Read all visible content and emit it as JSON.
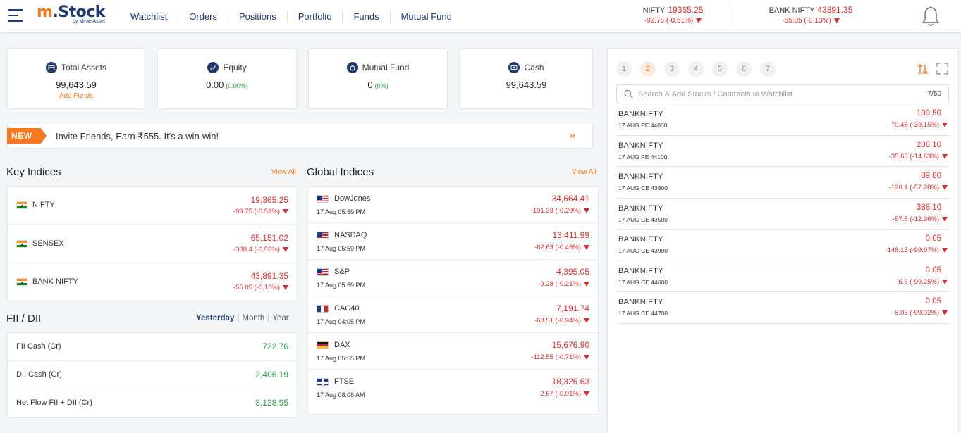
{
  "header": {
    "logo_text_m": "m",
    "logo_text": ".Stock",
    "logo_sub": "by Mirae Asset",
    "nav": [
      "Watchlist",
      "Orders",
      "Positions",
      "Portfolio",
      "Funds",
      "Mutual Fund"
    ],
    "tickers": [
      {
        "name": "NIFTY",
        "value": "19365.25",
        "change": "-99.75 (-0.51%)"
      },
      {
        "name": "BANK NIFTY",
        "value": "43891.35",
        "change": "-55.05 (-0.13%)"
      }
    ]
  },
  "summary": [
    {
      "title": "Total Assets",
      "value": "99,643.59",
      "extra": "",
      "link": "Add Funds"
    },
    {
      "title": "Equity",
      "value": "0.00",
      "extra": "(0.00%)",
      "link": ""
    },
    {
      "title": "Mutual Fund",
      "value": "0",
      "extra": "(0%)",
      "link": ""
    },
    {
      "title": "Cash",
      "value": "99,643.59",
      "extra": "",
      "link": ""
    }
  ],
  "banner": {
    "badge": "NEW",
    "text": "Invite Friends, Earn ₹555. It's a win-win!",
    "chevron": "»"
  },
  "key_indices": {
    "title": "Key Indices",
    "view_all": "View All",
    "rows": [
      {
        "name": "NIFTY",
        "price": "19,365.25",
        "change": "-99.75 (-0.51%)"
      },
      {
        "name": "SENSEX",
        "price": "65,151.02",
        "change": "-388.4 (-0.59%)"
      },
      {
        "name": "BANK NIFTY",
        "price": "43,891.35",
        "change": "-55.05 (-0.13%)"
      }
    ]
  },
  "global_indices": {
    "title": "Global Indices",
    "view_all": "View All",
    "rows": [
      {
        "name": "DowJones",
        "time": "17 Aug 05:59 PM",
        "price": "34,664.41",
        "change": "-101.33 (-0.29%)",
        "flag": "us"
      },
      {
        "name": "NASDAQ",
        "time": "17 Aug 05:59 PM",
        "price": "13,411.99",
        "change": "-62.63 (-0.46%)",
        "flag": "us"
      },
      {
        "name": "S&P",
        "time": "17 Aug 05:59 PM",
        "price": "4,395.05",
        "change": "-9.28 (-0.21%)",
        "flag": "us"
      },
      {
        "name": "CAC40",
        "time": "17 Aug 04:05 PM",
        "price": "7,191.74",
        "change": "-68.51 (-0.94%)",
        "flag": "fr"
      },
      {
        "name": "DAX",
        "time": "17 Aug 05:55 PM",
        "price": "15,676.90",
        "change": "-112.55 (-0.71%)",
        "flag": "de"
      },
      {
        "name": "FTSE",
        "time": "17 Aug 08:08 AM",
        "price": "18,326.63",
        "change": "-2.67 (-0.01%)",
        "flag": "gb"
      }
    ]
  },
  "fii_dii": {
    "title": "FII / DII",
    "tabs": [
      "Yesterday",
      "Month",
      "Year"
    ],
    "active_tab": "Yesterday",
    "rows": [
      {
        "name": "FII Cash (Cr)",
        "value": "722.76"
      },
      {
        "name": "DII Cash (Cr)",
        "value": "2,406.19"
      },
      {
        "name": "Net Flow FII + DII (Cr)",
        "value": "3,128.95"
      }
    ]
  },
  "watchlist": {
    "tabs": [
      "1",
      "2",
      "3",
      "4",
      "5",
      "6",
      "7"
    ],
    "active_tab": "2",
    "search_placeholder": "Search & Add Stocks / Contracts to Watchlist",
    "count": "7/50",
    "items": [
      {
        "symbol": "BANKNIFTY",
        "contract": "17 AUG PE 44000",
        "price": "109.50",
        "change": "-70.45 (-39.15%)"
      },
      {
        "symbol": "BANKNIFTY",
        "contract": "17 AUG PE 44100",
        "price": "208.10",
        "change": "-35.65 (-14.63%)"
      },
      {
        "symbol": "BANKNIFTY",
        "contract": "17 AUG CE 43800",
        "price": "89.80",
        "change": "-120.4 (-57.28%)"
      },
      {
        "symbol": "BANKNIFTY",
        "contract": "17 AUG CE 43500",
        "price": "388.10",
        "change": "-57.8 (-12.96%)"
      },
      {
        "symbol": "BANKNIFTY",
        "contract": "17 AUG CE 43900",
        "price": "0.05",
        "change": "-148.15 (-99.97%)"
      },
      {
        "symbol": "BANKNIFTY",
        "contract": "17 AUG CE 44600",
        "price": "0.05",
        "change": "-6.6 (-99.25%)"
      },
      {
        "symbol": "BANKNIFTY",
        "contract": "17 AUG CE 44700",
        "price": "0.05",
        "change": "-5.05 (-99.02%)"
      }
    ]
  },
  "colors": {
    "brand_orange": "#f47920",
    "brand_navy": "#1f3a6b",
    "negative": "#d32f2f",
    "positive": "#2e9d4a"
  }
}
